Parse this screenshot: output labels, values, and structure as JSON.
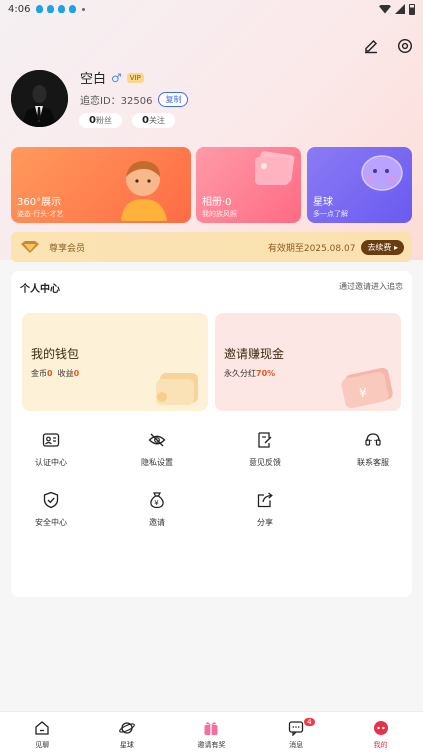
{
  "status_bar": {
    "time": "4:06"
  },
  "profile": {
    "name": "空白",
    "gender_symbol": "♂",
    "vip_label": "VIP",
    "id_label": "追恋ID：",
    "id_value": "32506",
    "copy_label": "复制",
    "fans_count": "0",
    "fans_label": "粉丝",
    "follow_count": "0",
    "follow_label": "关注"
  },
  "cards": [
    {
      "title": "360°展示",
      "subtitle": "姿态·行头·才艺"
    },
    {
      "title": "相册·0",
      "subtitle": "我的族风照"
    },
    {
      "title": "星球",
      "subtitle": "多一点了解"
    }
  ],
  "vip_banner": {
    "label": "尊享会员",
    "expiry": "有效期至2025.08.07",
    "renew_label": "去续费 ▸"
  },
  "center": {
    "title": "个人中心",
    "link": "通过邀请进入追恋",
    "wallet": {
      "title": "我的钱包",
      "coins_label": "金币",
      "coins": "0",
      "income_label": "收益",
      "income": "0"
    },
    "invite": {
      "title": "邀请赚现金",
      "desc_label": "永久分红",
      "percent": "70%"
    },
    "grid": [
      {
        "label": "认证中心",
        "icon": "id-card-icon"
      },
      {
        "label": "隐私设置",
        "icon": "eye-off-icon"
      },
      {
        "label": "意见反馈",
        "icon": "feedback-icon"
      },
      {
        "label": "联系客服",
        "icon": "headset-icon"
      },
      {
        "label": "安全中心",
        "icon": "shield-icon"
      },
      {
        "label": "邀请",
        "icon": "money-bag-icon"
      },
      {
        "label": "分享",
        "icon": "share-icon"
      }
    ]
  },
  "tabbar": [
    {
      "label": "见聊",
      "icon": "home-icon"
    },
    {
      "label": "星球",
      "icon": "planet-icon"
    },
    {
      "label": "邀请有奖",
      "icon": "gift-icon"
    },
    {
      "label": "消息",
      "icon": "message-icon",
      "badge": "4"
    },
    {
      "label": "我的",
      "icon": "me-icon",
      "active": true
    }
  ],
  "colors": {
    "accent": "#e8324a",
    "link_blue": "#3c6df0",
    "vip_brown": "#6b3c10"
  }
}
